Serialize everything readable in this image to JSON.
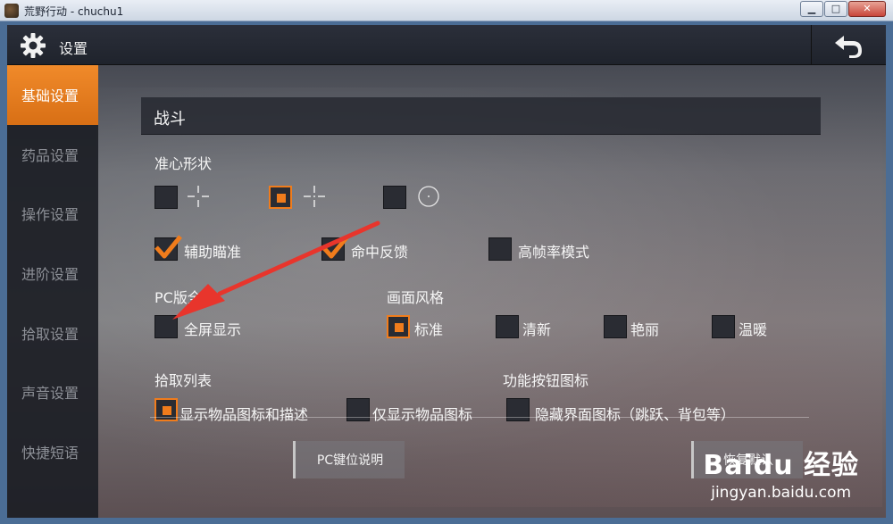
{
  "window": {
    "title": "荒野行动 - chuchu1",
    "min": "▁",
    "max": "□",
    "close": "✕"
  },
  "header": {
    "title": "设置"
  },
  "sidebar": {
    "items": [
      "基础设置",
      "药品设置",
      "操作设置",
      "进阶设置",
      "拾取设置",
      "声音设置",
      "快捷短语"
    ]
  },
  "content": {
    "section": "战斗",
    "crosshair": {
      "label": "准心形状"
    },
    "assist": {
      "aim": "辅助瞄准",
      "hit": "命中反馈",
      "fps": "高帧率模式"
    },
    "pc": {
      "label": "PC版全屏",
      "fullscreen": "全屏显示"
    },
    "style": {
      "label": "画面风格",
      "options": [
        "标准",
        "清新",
        "艳丽",
        "温暖"
      ]
    },
    "pickup": {
      "label": "拾取列表",
      "opt1": "显示物品图标和描述",
      "opt2": "仅显示物品图标"
    },
    "func": {
      "label": "功能按钮图标",
      "opt1": "隐藏界面图标（跳跃、背包等）"
    },
    "buttons": {
      "pc_keys": "PC键位说明",
      "restore": "恢复默认"
    }
  },
  "watermark": {
    "brand": "Baidu 经验",
    "url": "jingyan.baidu.com"
  },
  "colors": {
    "accent": "#f07c1c",
    "sidebar_active": "#e57d1f"
  }
}
